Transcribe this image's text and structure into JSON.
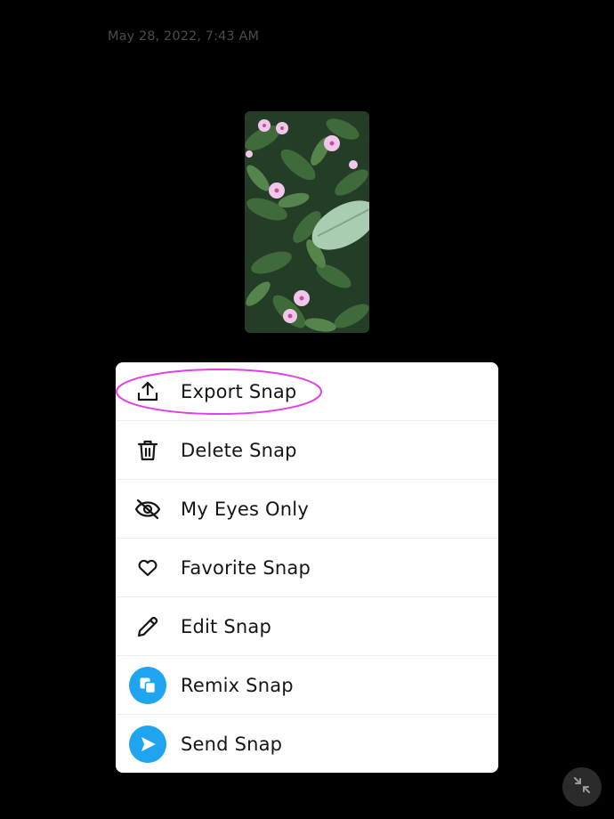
{
  "timestamp": "May 28, 2022, 7:43 AM",
  "menu": {
    "items": [
      {
        "label": "Export Snap",
        "icon": "upload-icon"
      },
      {
        "label": "Delete Snap",
        "icon": "trash-icon"
      },
      {
        "label": "My Eyes Only",
        "icon": "eye-off-icon"
      },
      {
        "label": "Favorite Snap",
        "icon": "heart-icon"
      },
      {
        "label": "Edit Snap",
        "icon": "pencil-icon"
      },
      {
        "label": "Remix Snap",
        "icon": "remix-icon"
      },
      {
        "label": "Send Snap",
        "icon": "send-icon"
      }
    ]
  },
  "colors": {
    "background": "#000000",
    "menu_background": "#ffffff",
    "accent_blue": "#1fa4f0",
    "highlight_magenta": "#e040e6"
  },
  "collapse_button": {
    "icon": "collapse-icon"
  }
}
